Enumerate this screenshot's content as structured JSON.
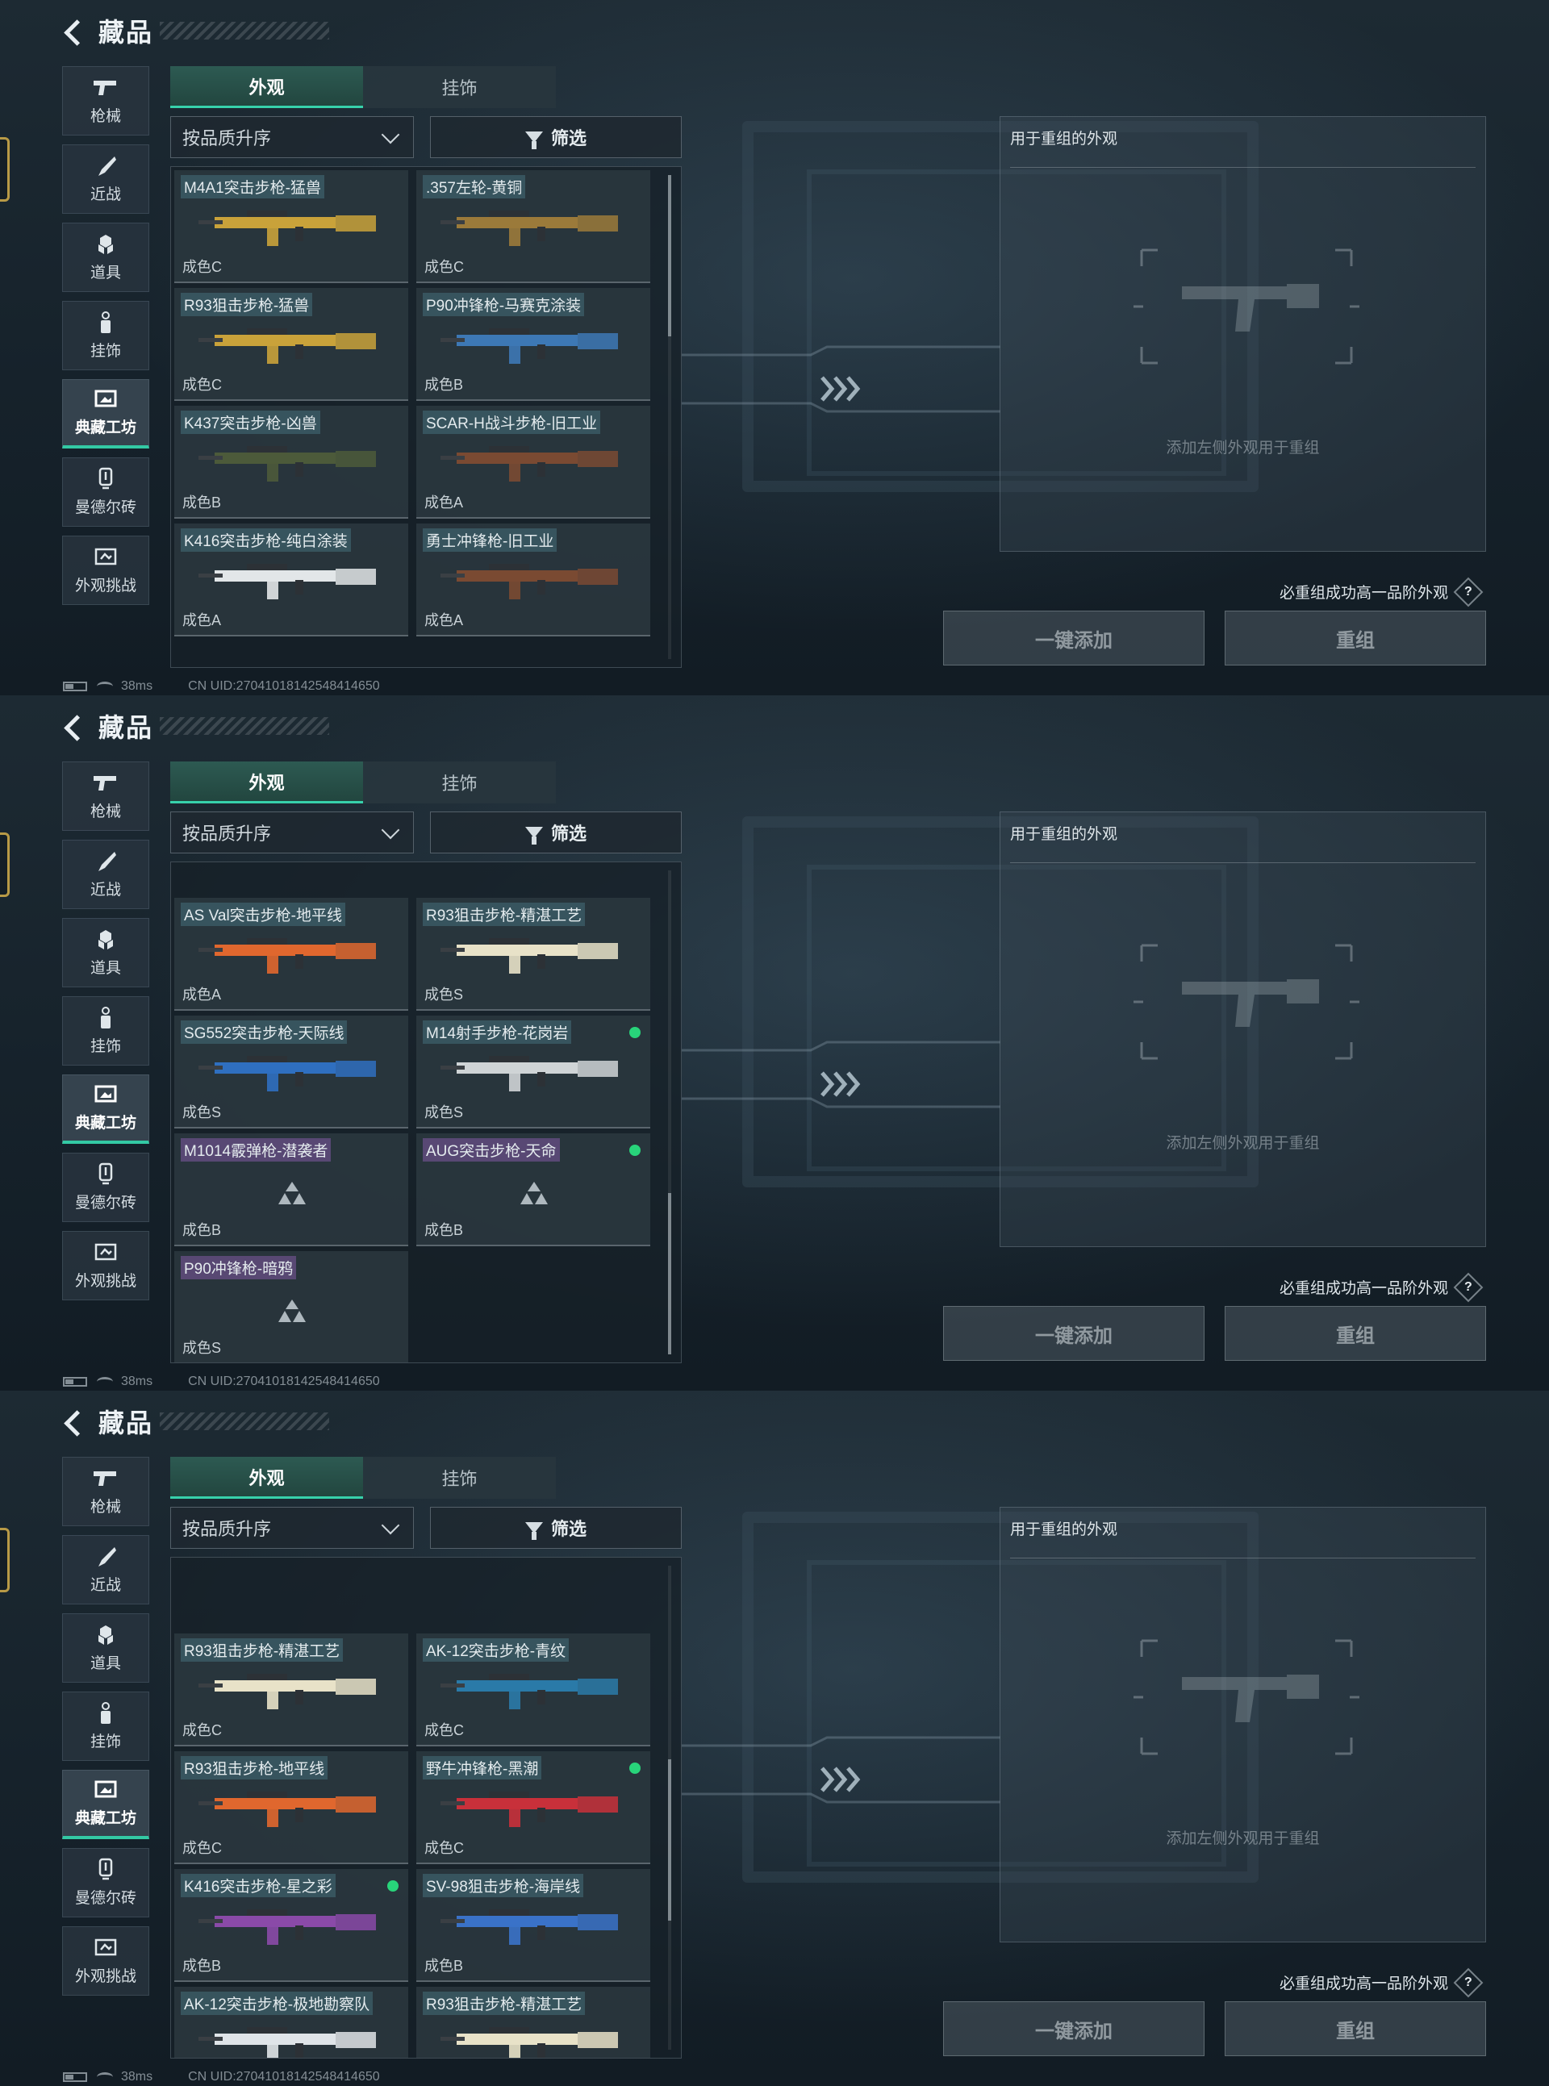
{
  "screens": [
    {
      "title": "藏品",
      "nav": [
        {
          "label": "枪械",
          "icon": "gun-icon"
        },
        {
          "label": "近战",
          "icon": "knife-icon"
        },
        {
          "label": "道具",
          "icon": "items-icon"
        },
        {
          "label": "挂饰",
          "icon": "charm-icon"
        },
        {
          "label": "典藏工坊",
          "icon": "workshop-icon",
          "active": true
        },
        {
          "label": "曼德尔砖",
          "icon": "brick-icon"
        },
        {
          "label": "外观挑战",
          "icon": "challenge-icon"
        }
      ],
      "tabs": [
        {
          "label": "外观",
          "active": true
        },
        {
          "label": "挂饰"
        }
      ],
      "sort_label": "按品质升序",
      "filter_label": "筛选",
      "scroll_fraction": 0.0,
      "cards": [
        {
          "name": "M4A1突击步枪-猛兽",
          "grade": "成色C",
          "color": "#c9a23a",
          "purple": false,
          "dot": false
        },
        {
          "name": ".357左轮-黄铜",
          "grade": "成色C",
          "color": "#9b7a3a",
          "purple": false,
          "dot": false
        },
        {
          "name": "R93狙击步枪-猛兽",
          "grade": "成色C",
          "color": "#c9a23a",
          "purple": false,
          "dot": false
        },
        {
          "name": "P90冲锋枪-马赛克涂装",
          "grade": "成色B",
          "color": "#3d78b5",
          "purple": false,
          "dot": false
        },
        {
          "name": "K437突击步枪-凶兽",
          "grade": "成色B",
          "color": "#4c5a3a",
          "purple": false,
          "dot": false
        },
        {
          "name": "SCAR-H战斗步枪-旧工业",
          "grade": "成色A",
          "color": "#7a4a32",
          "purple": false,
          "dot": false
        },
        {
          "name": "K416突击步枪-纯白涂装",
          "grade": "成色A",
          "color": "#e2e6e8",
          "purple": false,
          "dot": false
        },
        {
          "name": "勇士冲锋枪-旧工业",
          "grade": "成色A",
          "color": "#7a4a32",
          "purple": false,
          "dot": false
        }
      ],
      "right_panel": {
        "title": "用于重组的外观",
        "hint": "添加左侧外观用于重组"
      },
      "note": "必重组成功高一品阶外观",
      "buttons": {
        "add": "一键添加",
        "recombine": "重组"
      },
      "status": {
        "ping": "38ms",
        "uid": "CN UID:27041018142548414650"
      }
    },
    {
      "title": "藏品",
      "nav": [
        {
          "label": "枪械",
          "icon": "gun-icon"
        },
        {
          "label": "近战",
          "icon": "knife-icon"
        },
        {
          "label": "道具",
          "icon": "items-icon"
        },
        {
          "label": "挂饰",
          "icon": "charm-icon"
        },
        {
          "label": "典藏工坊",
          "icon": "workshop-icon",
          "active": true
        },
        {
          "label": "曼德尔砖",
          "icon": "brick-icon"
        },
        {
          "label": "外观挑战",
          "icon": "challenge-icon"
        }
      ],
      "tabs": [
        {
          "label": "外观",
          "active": true
        },
        {
          "label": "挂饰"
        }
      ],
      "sort_label": "按品质升序",
      "filter_label": "筛选",
      "scroll_fraction": 1.0,
      "cards": [
        {
          "name": "AS Val突击步枪-地平线",
          "grade": "成色A",
          "color": "#e0672e",
          "purple": false,
          "dot": false
        },
        {
          "name": "R93狙击步枪-精湛工艺",
          "grade": "成色S",
          "color": "#e8e2c8",
          "purple": false,
          "dot": false
        },
        {
          "name": "SG552突击步枪-天际线",
          "grade": "成色S",
          "color": "#2f6fc0",
          "purple": false,
          "dot": false
        },
        {
          "name": "M14射手步枪-花岗岩",
          "grade": "成色S",
          "color": "#cfd4d6",
          "purple": false,
          "dot": true
        },
        {
          "name": "M1014霰弹枪-潜袭者",
          "grade": "成色B",
          "color": "",
          "purple": true,
          "dot": false
        },
        {
          "name": "AUG突击步枪-天命",
          "grade": "成色B",
          "color": "",
          "purple": true,
          "dot": true
        },
        {
          "name": "P90冲锋枪-暗鸦",
          "grade": "成色S",
          "color": "",
          "purple": true,
          "dot": false
        }
      ],
      "right_panel": {
        "title": "用于重组的外观",
        "hint": "添加左侧外观用于重组"
      },
      "note": "必重组成功高一品阶外观",
      "buttons": {
        "add": "一键添加",
        "recombine": "重组"
      },
      "status": {
        "ping": "38ms",
        "uid": "CN UID:27041018142548414650"
      }
    },
    {
      "title": "藏品",
      "nav": [
        {
          "label": "枪械",
          "icon": "gun-icon"
        },
        {
          "label": "近战",
          "icon": "knife-icon"
        },
        {
          "label": "道具",
          "icon": "items-icon"
        },
        {
          "label": "挂饰",
          "icon": "charm-icon"
        },
        {
          "label": "典藏工坊",
          "icon": "workshop-icon",
          "active": true
        },
        {
          "label": "曼德尔砖",
          "icon": "brick-icon"
        },
        {
          "label": "外观挑战",
          "icon": "challenge-icon"
        }
      ],
      "tabs": [
        {
          "label": "外观",
          "active": true
        },
        {
          "label": "挂饰"
        }
      ],
      "sort_label": "按品质升序",
      "filter_label": "筛选",
      "scroll_fraction": 0.6,
      "cards": [
        {
          "name": "R93狙击步枪-精湛工艺",
          "grade": "成色C",
          "color": "#e8e2c8",
          "purple": false,
          "dot": false
        },
        {
          "name": "AK-12突击步枪-青纹",
          "grade": "成色C",
          "color": "#2a7aa8",
          "purple": false,
          "dot": false
        },
        {
          "name": "R93狙击步枪-地平线",
          "grade": "成色C",
          "color": "#e0672e",
          "purple": false,
          "dot": false
        },
        {
          "name": "野牛冲锋枪-黑潮",
          "grade": "成色C",
          "color": "#c8303a",
          "purple": false,
          "dot": true
        },
        {
          "name": "K416突击步枪-星之彩",
          "grade": "成色B",
          "color": "#8a4aa8",
          "purple": false,
          "dot": true
        },
        {
          "name": "SV-98狙击步枪-海岸线",
          "grade": "成色B",
          "color": "#3a72c8",
          "purple": false,
          "dot": false
        },
        {
          "name": "AK-12突击步枪-极地勘察队",
          "grade": "",
          "color": "#dfe4e8",
          "purple": false,
          "dot": false
        },
        {
          "name": "R93狙击步枪-精湛工艺",
          "grade": "",
          "color": "#e8e2c8",
          "purple": false,
          "dot": false
        }
      ],
      "right_panel": {
        "title": "用于重组的外观",
        "hint": "添加左侧外观用于重组"
      },
      "note": "必重组成功高一品阶外观",
      "buttons": {
        "add": "一键添加",
        "recombine": "重组"
      },
      "status": {
        "ping": "38ms",
        "uid": "CN UID:27041018142548414650"
      }
    }
  ]
}
